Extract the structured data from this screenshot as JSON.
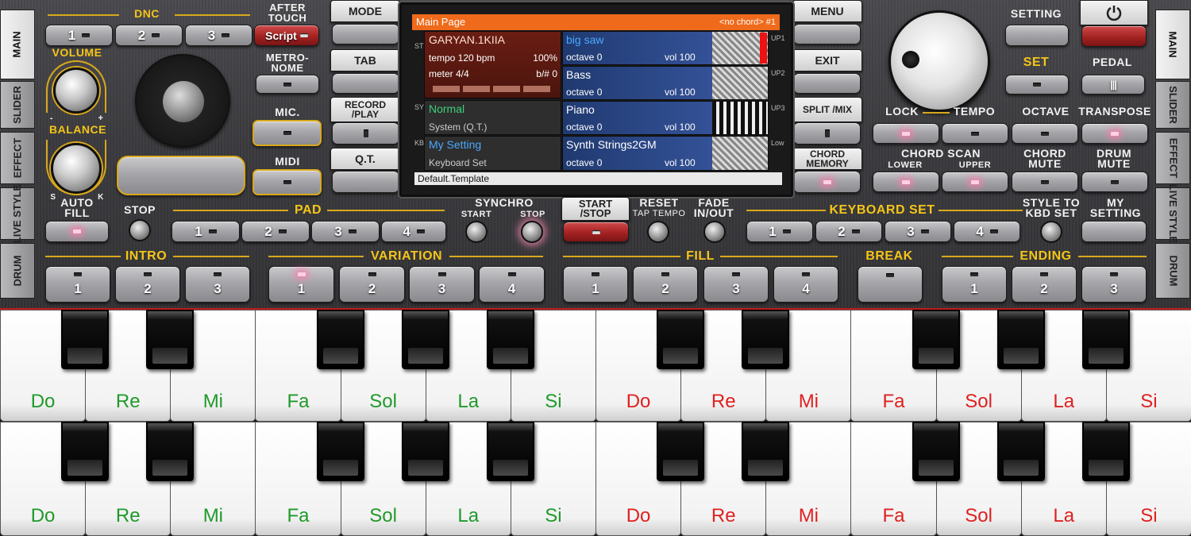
{
  "left_tabs": [
    "MAIN",
    "SLIDER",
    "EFFECT",
    "LIVE STYLE",
    "DRUM"
  ],
  "right_tabs": [
    "MAIN",
    "SLIDER",
    "EFFECT",
    "LIVE STYLE",
    "DRUM"
  ],
  "dnc": {
    "label": "DNC",
    "buttons": [
      "1",
      "2",
      "3"
    ],
    "script": "Script"
  },
  "after_touch": "AFTER TOUCH",
  "volume": "VOLUME",
  "balance": "BALANCE",
  "minus": "-",
  "plus": "+",
  "s": "S",
  "k": "K",
  "metronome": "METRO- NOME",
  "mic": "MIC.",
  "midi": "MIDI",
  "center_left_buttons": [
    "MODE",
    "TAB",
    "RECORD /PLAY",
    "Q.T."
  ],
  "center_right_buttons": [
    "MENU",
    "EXIT",
    "SPLIT /MIX",
    "CHORD MEMORY"
  ],
  "screen": {
    "title": "Main Page",
    "chord": "<no chord> #1",
    "style": {
      "name": "GARYAN.1KIIA",
      "tempo": "tempo 120 bpm",
      "pct": "100%",
      "meter": "meter 4/4",
      "bsharp": "b/# 0",
      "tag": "STYLE"
    },
    "sys": {
      "name": "Normal",
      "sub": "System (Q.T.)",
      "tag": "SYS"
    },
    "kbd": {
      "name": "My Setting",
      "sub": "Keyboard Set",
      "tag": "KBD"
    },
    "instruments": [
      {
        "name": "big saw",
        "octave": "octave  0",
        "vol": "vol 100",
        "tag": "UP1"
      },
      {
        "name": "Bass",
        "octave": "octave  0",
        "vol": "vol 100",
        "tag": "UP2"
      },
      {
        "name": "Piano",
        "octave": "octave  0",
        "vol": "vol 100",
        "tag": "UP3"
      },
      {
        "name": "Synth Strings2GM",
        "octave": "octave  0",
        "vol": "vol 100",
        "tag": "Low"
      }
    ],
    "footer": "Default.Template"
  },
  "right": {
    "setting": "SETTING",
    "set": "SET",
    "pedal": "PEDAL",
    "lock": "LOCK",
    "tempo": "TEMPO",
    "octave": "OCTAVE",
    "transpose": "TRANSPOSE",
    "chord_scan": "CHORD SCAN",
    "lower": "LOWER",
    "upper": "UPPER",
    "chord_mute": "CHORD MUTE",
    "drum_mute": "DRUM MUTE",
    "style_to_kbd": "STYLE TO KBD SET",
    "my_setting": "MY SETTING"
  },
  "auto_fill": "AUTO FILL",
  "stop": "STOP",
  "pad": {
    "label": "PAD",
    "buttons": [
      "1",
      "2",
      "3",
      "4"
    ]
  },
  "synchro": "SYNCHRO",
  "synchro_start": "START",
  "synchro_stop": "STOP",
  "start_stop": "START /STOP",
  "reset": "RESET",
  "tap_tempo": "TAP TEMPO",
  "fade": "FADE IN/OUT",
  "keyboard_set": {
    "label": "KEYBOARD SET",
    "buttons": [
      "1",
      "2",
      "3",
      "4"
    ]
  },
  "intro": {
    "label": "INTRO",
    "buttons": [
      "1",
      "2",
      "3"
    ]
  },
  "variation": {
    "label": "VARIATION",
    "buttons": [
      "1",
      "2",
      "3",
      "4"
    ]
  },
  "fill": {
    "label": "FILL",
    "buttons": [
      "1",
      "2",
      "3",
      "4"
    ]
  },
  "break": "BREAK",
  "ending": {
    "label": "ENDING",
    "buttons": [
      "1",
      "2",
      "3"
    ]
  },
  "notes_upper": [
    "Do",
    "Re",
    "Mi",
    "Fa",
    "Sol",
    "La",
    "Si",
    "Do",
    "Re",
    "Mi",
    "Fa",
    "Sol",
    "La",
    "Si"
  ],
  "notes_lower": [
    "Do",
    "Re",
    "Mi",
    "Fa",
    "Sol",
    "La",
    "Si",
    "Do",
    "Re",
    "Mi",
    "Fa",
    "Sol",
    "La",
    "Si"
  ],
  "colors": {
    "accent_yellow": "#f5c518",
    "note_green": "#1f9a2a",
    "note_red": "#e02020",
    "screen_header": "#ef6a1a"
  }
}
